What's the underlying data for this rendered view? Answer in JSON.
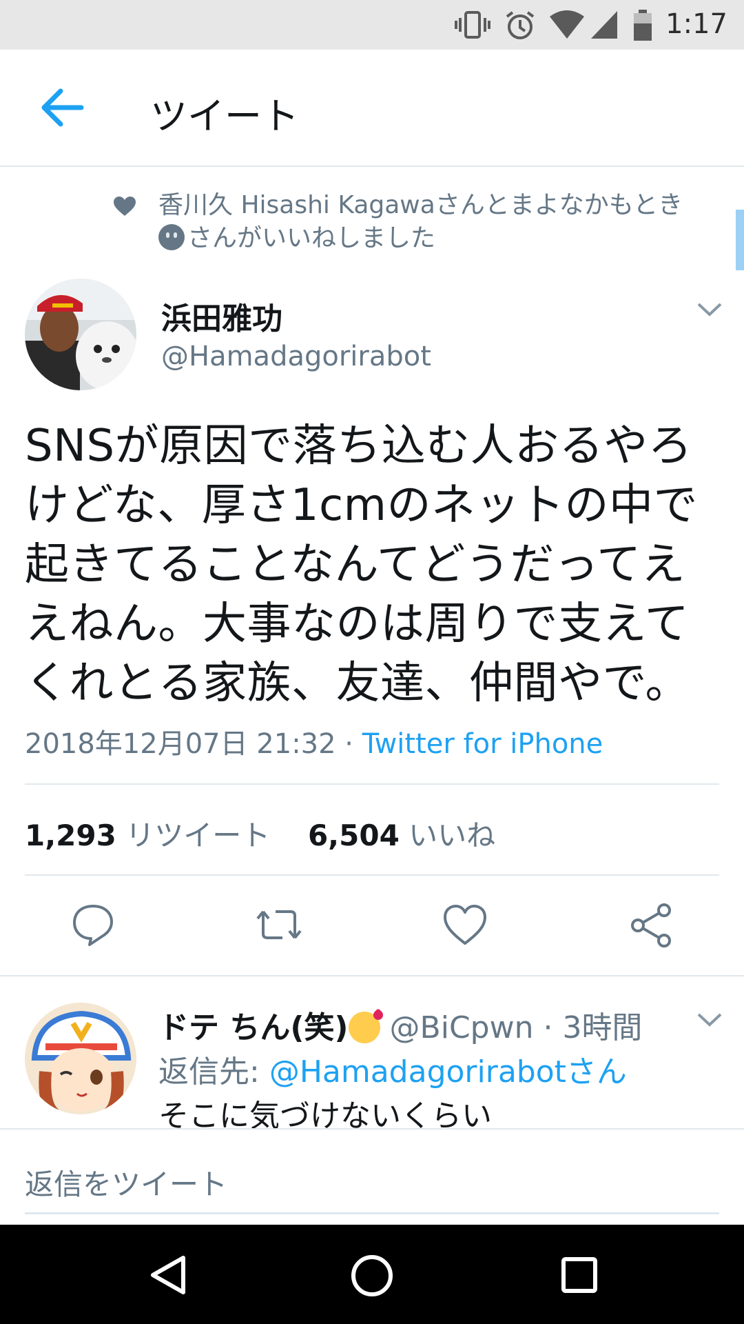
{
  "status_bar": {
    "time": "1:17"
  },
  "header": {
    "title": "ツイート",
    "back_icon": "arrow-left-icon"
  },
  "social_context": {
    "text_line1": "香川久 Hisashi Kagawaさんとまよなかもとき",
    "text_line2": "さんがいいねしました"
  },
  "tweet": {
    "author_name": "浜田雅功",
    "author_handle": "@Hamadagorirabot",
    "text_lines": [
      "SNSが原因で落ち込む人おるやろ",
      "けどな、厚さ1cmのネットの中で",
      "起きてることなんてどうだってえ",
      "えねん。大事なのは周りで支えて",
      "くれとる家族、友達、仲間やで。"
    ],
    "timestamp": "2018年12月07日 21:32",
    "separator": " · ",
    "source": "Twitter for iPhone",
    "retweet_count": "1,293",
    "retweet_label": "リツイート",
    "like_count": "6,504",
    "like_label": "いいね"
  },
  "reply": {
    "name": "ドテ ちん(笑)",
    "handle": "@BiCpwn",
    "time": " · 3時間",
    "reply_to_label": "返信先: ",
    "reply_to_handle": "@Hamadagorirabotさん",
    "text": "そこに気づけないくらい"
  },
  "compose": {
    "placeholder": "返信をツイート"
  },
  "colors": {
    "accent": "#1da1f2",
    "secondary_text": "#657786",
    "divider": "#e1e8ed"
  }
}
